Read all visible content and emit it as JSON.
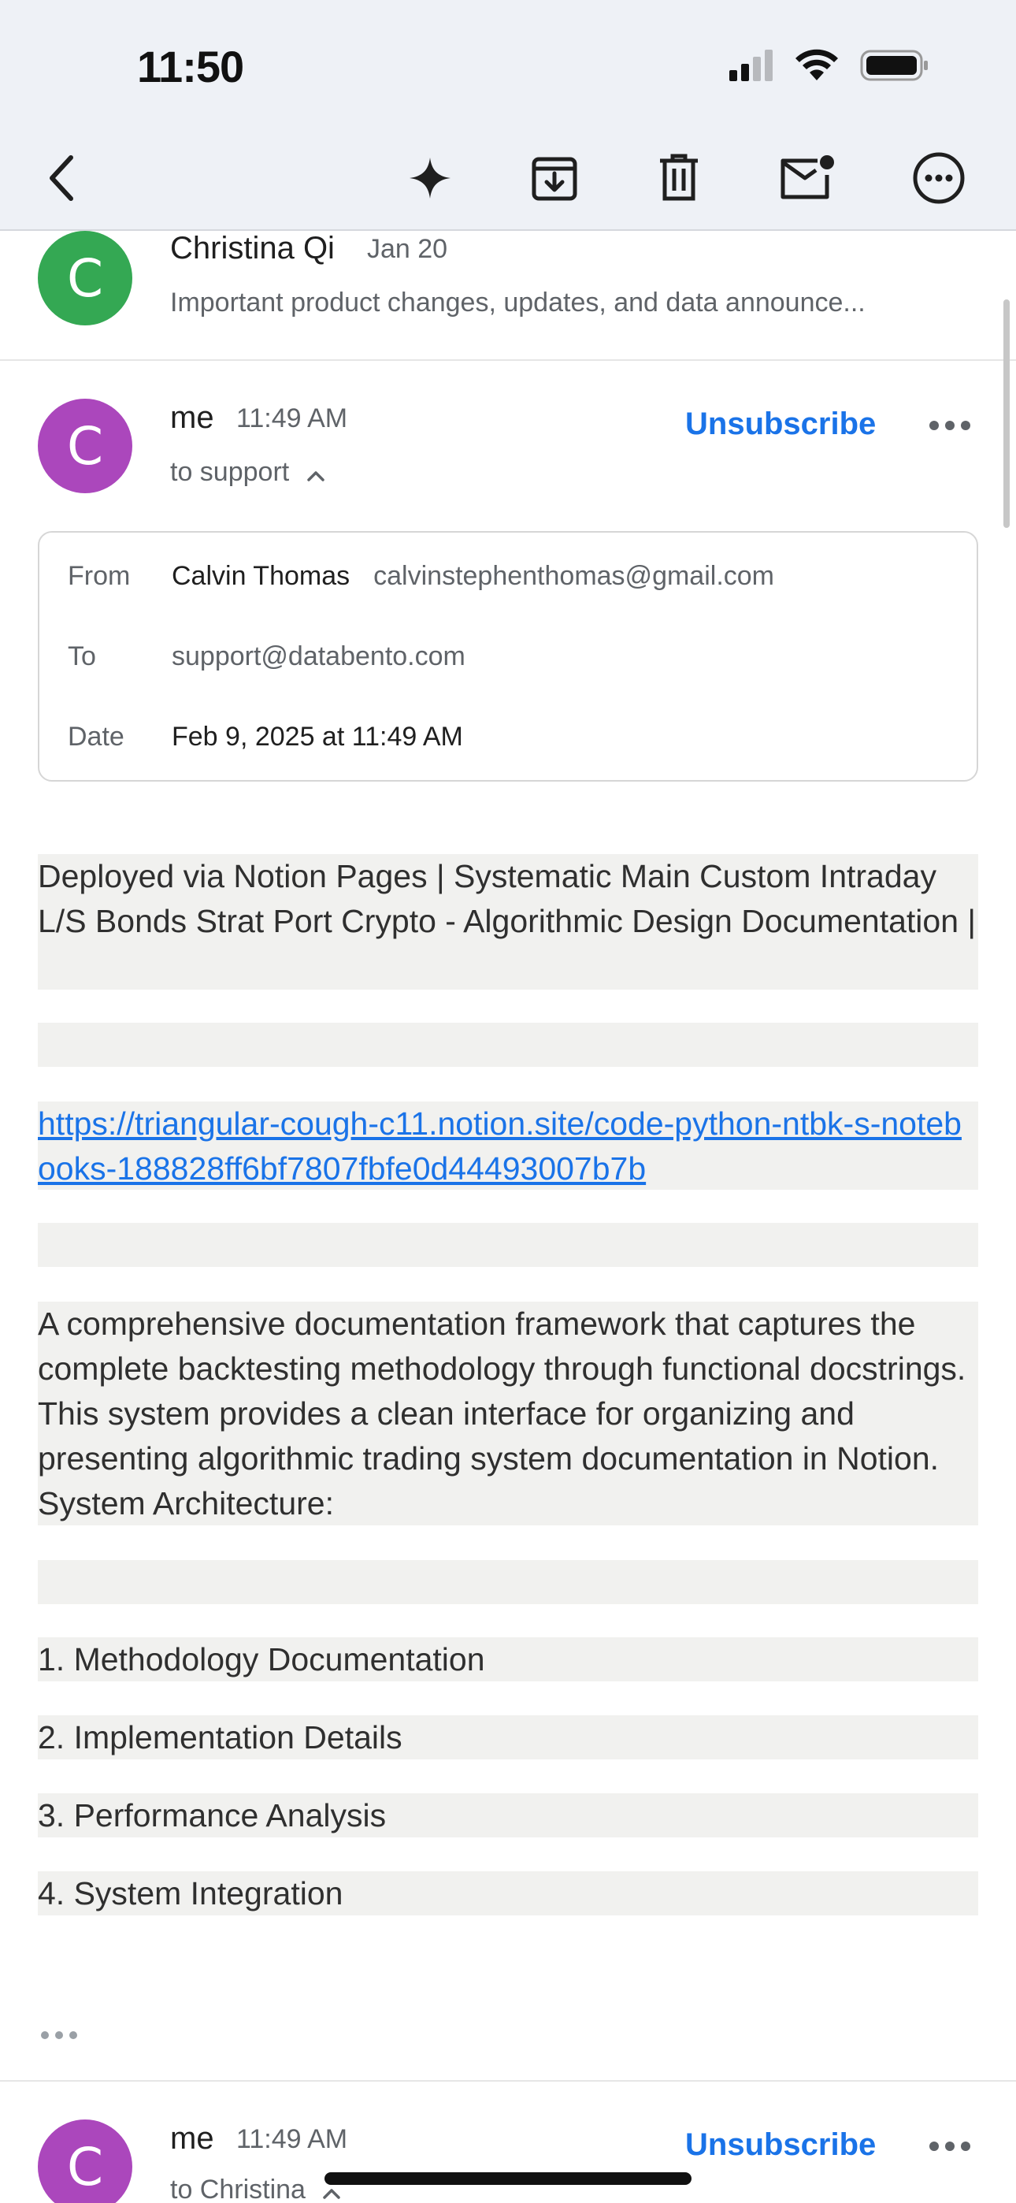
{
  "status_bar": {
    "time": "11:50"
  },
  "toolbar": {
    "icons": [
      "back-icon",
      "sparkle-icon",
      "archive-icon",
      "trash-icon",
      "mark-unread-icon",
      "more-icon"
    ]
  },
  "previous_message": {
    "avatar_letter": "C",
    "sender": "Christina Qi",
    "date": "Jan 20",
    "snippet": "Important product changes, updates, and data announce..."
  },
  "message": {
    "avatar_letter": "C",
    "sender": "me",
    "time": "11:49 AM",
    "to_line": "to support",
    "unsubscribe": "Unsubscribe",
    "details": {
      "from_label": "From",
      "from_name": "Calvin Thomas",
      "from_email": "calvinstephenthomas@gmail.com",
      "to_label": "To",
      "to_value": "support@databento.com",
      "date_label": "Date",
      "date_value": "Feb 9, 2025 at 11:49 AM"
    },
    "body": {
      "intro": "Deployed via Notion Pages | Systematic Main Custom Intraday L/S Bonds Strat Port Crypto - Algorithmic Design Documentation |",
      "link": "https://triangular-cough-c11.notion.site/code-python-ntbk-s-notebooks-188828ff6bf7807fbfe0d44493007b7b",
      "description": "A comprehensive documentation framework that captures the complete backtesting methodology through functional docstrings. This system provides a clean interface for organizing and presenting algorithmic trading system documentation in Notion. System Architecture:",
      "items": [
        "1. Methodology Documentation",
        "2. Implementation Details",
        "3. Performance Analysis",
        "4. System Integration"
      ]
    }
  },
  "next_message": {
    "avatar_letter": "C",
    "sender": "me",
    "time": "11:49 AM",
    "to_line": "to Christina",
    "unsubscribe": "Unsubscribe"
  },
  "colors": {
    "link": "#1a73e8",
    "avatar_green": "#34a853",
    "avatar_purple": "#ab47bc",
    "block_bg": "#f1f1ef"
  }
}
